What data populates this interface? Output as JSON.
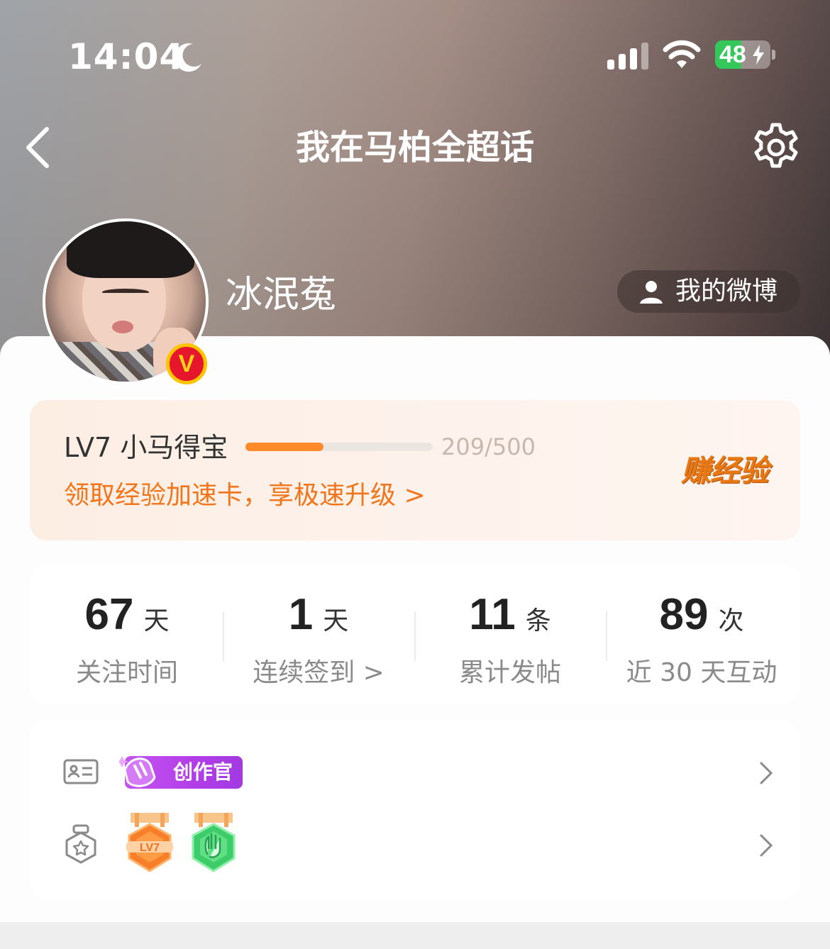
{
  "status_bar": {
    "time": "14:04",
    "battery": "48"
  },
  "nav": {
    "title": "我在马柏全超话"
  },
  "profile": {
    "username": "冰泯菟",
    "verified_badge": "V",
    "my_weibo_label": "我的微博"
  },
  "level": {
    "name": "LV7 小马得宝",
    "progress_text": "209/500",
    "progress_current": 209,
    "progress_max": 500,
    "speedup_text": "领取经验加速卡，享极速升级 >",
    "earn_label": "赚经验"
  },
  "stats": [
    {
      "value": "67",
      "unit": "天",
      "label": "关注时间"
    },
    {
      "value": "1",
      "unit": "天",
      "label": "连续签到 >"
    },
    {
      "value": "11",
      "unit": "条",
      "label": "累计发帖"
    },
    {
      "value": "89",
      "unit": "次",
      "label": "近 30 天互动"
    }
  ],
  "badges": {
    "creator_label": "创作官",
    "medal_lv_label": "LV7"
  },
  "colors": {
    "accent_orange": "#f2751a",
    "progress_fill": "#ff8a2b",
    "verified_red": "#e6162d",
    "creator_purple": "#b23de8",
    "battery_green": "#34c759"
  }
}
